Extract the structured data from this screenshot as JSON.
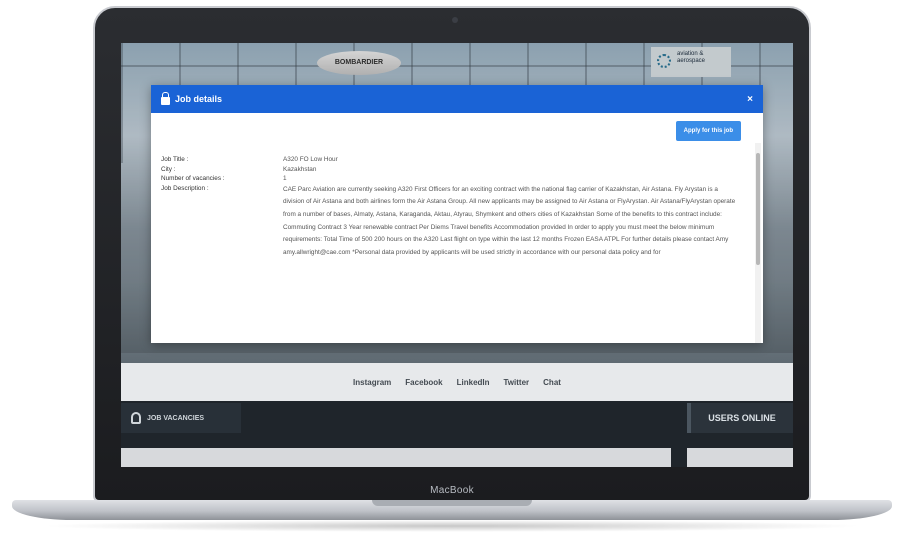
{
  "device": {
    "label": "MacBook"
  },
  "background": {
    "blimp_text": "BOMBARDIER",
    "sponsor_text": "aviation & aerospace",
    "social_links": [
      "Instagram",
      "Facebook",
      "LinkedIn",
      "Twitter",
      "Chat"
    ],
    "jobs_tab": "JOB VACANCIES",
    "users_online": "USERS ONLINE"
  },
  "modal": {
    "title": "Job details",
    "apply_label": "Apply for this job",
    "fields": {
      "job_title": {
        "label": "Job Title :",
        "value": "A320 FO Low Hour"
      },
      "city": {
        "label": "City :",
        "value": "Kazakhstan"
      },
      "vacancies": {
        "label": "Number of vacancies :",
        "value": "1"
      },
      "description": {
        "label": "Job Description :",
        "value": "CAE Parc Aviation are currently seeking A320 First Officers for an exciting contract with the national flag carrier of Kazakhstan, Air Astana. Fly Arystan is a division of Air Astana and both airlines form the Air Astana Group. All new applicants may be assigned to Air Astana or FlyArystan. Air Astana/FlyArystan operate from a number of bases, Almaty, Astana, Karaganda, Aktau, Atyrau, Shymkent and others cities of Kazakhstan Some of the benefits to this contract include: Commuting Contract 3 Year renewable contract Per Diems Travel benefits Accommodation provided In order to apply you must meet the below minimum requirements: Total Time of 500 200 hours on the A320 Last flight on type within the last 12 months Frozen EASA ATPL For further details please contact Amy amy.allwright@cae.com *Personal data provided by applicants will be used strictly in accordance with our personal data policy and for"
      }
    }
  }
}
